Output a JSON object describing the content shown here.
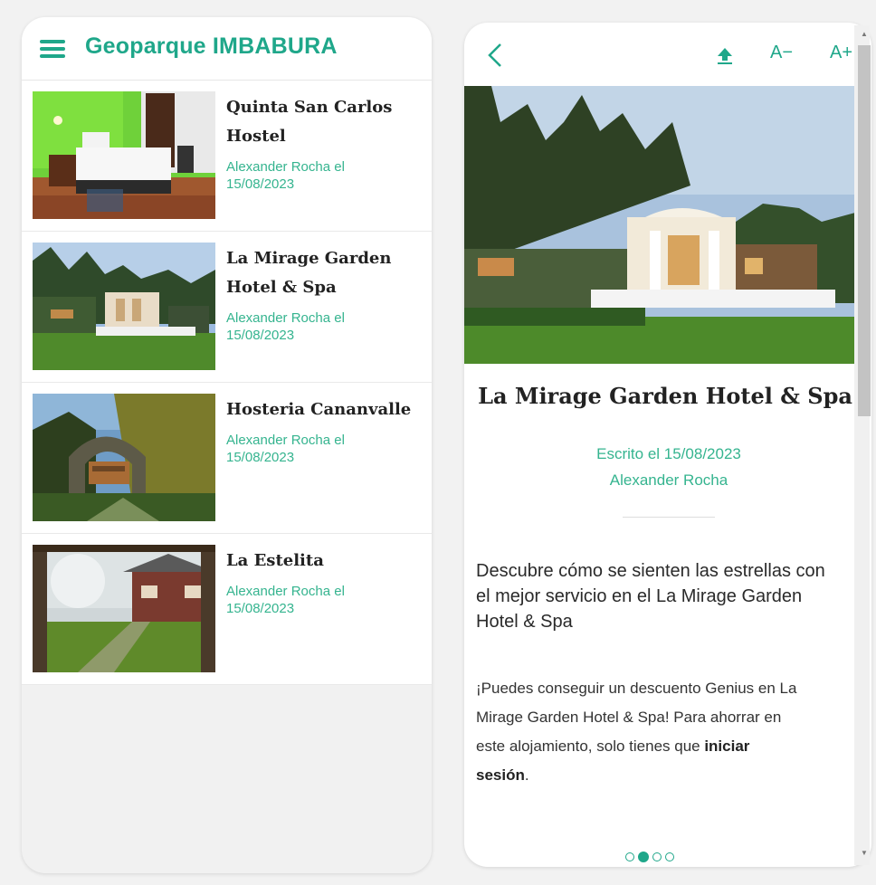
{
  "left_app": {
    "title": "Geoparque IMBABURA",
    "posts": [
      {
        "title_line1": "Quinta San Carlos",
        "title_line2": "Hostel",
        "author_line1": "Alexander Rocha el",
        "author_line2": "15/08/2023"
      },
      {
        "title_line1": "La Mirage Garden",
        "title_line2": "Hotel & Spa",
        "author_line1": "Alexander Rocha el",
        "author_line2": "15/08/2023"
      },
      {
        "title_line1": "Hosteria Cananvalle",
        "title_line2": "",
        "author_line1": "Alexander Rocha el",
        "author_line2": "15/08/2023"
      },
      {
        "title_line1": "La Estelita",
        "title_line2": "",
        "author_line1": "Alexander Rocha el",
        "author_line2": "15/08/2023"
      }
    ]
  },
  "right_app": {
    "toolbar": {
      "font_decrease": "A−",
      "font_increase": "A+"
    },
    "article": {
      "title": "La Mirage Garden Hotel & Spa",
      "written": "Escrito el 15/08/2023",
      "author": "Alexander Rocha",
      "lead_line1": "Descubre cómo se sienten las estrellas con",
      "lead_line2": "el mejor servicio en el La Mirage Garden",
      "lead_line3": "Hotel & Spa",
      "body_line1": "¡Puedes conseguir un descuento Genius en La",
      "body_line2": "Mirage Garden Hotel & Spa! Para ahorrar en",
      "body_line3_prefix": "este alojamiento, solo tienes que ",
      "body_bold_1": "iniciar",
      "body_bold_2": "sesión",
      "body_end": "."
    },
    "pager": {
      "active_index": 1,
      "count": 4
    }
  },
  "colors": {
    "accent": "#1fa78a",
    "author_text": "#35b48f"
  },
  "icons": {
    "menu": "hamburger-menu-icon",
    "back": "chevron-left-icon",
    "share": "upload-icon"
  }
}
